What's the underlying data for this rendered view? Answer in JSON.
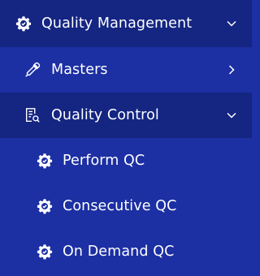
{
  "colors": {
    "header_bg": "#142582",
    "item_bg": "#1c2fa3",
    "text": "#ffffff"
  },
  "menu": {
    "group": {
      "label": "Quality Management",
      "icon": "gear-icon",
      "expanded": true,
      "chevron": "chevron-down-icon"
    },
    "masters": {
      "label": "Masters",
      "icon": "pipette-icon",
      "chevron": "chevron-right-icon"
    },
    "quality_control": {
      "label": "Quality Control",
      "icon": "report-search-icon",
      "expanded": true,
      "chevron": "chevron-down-icon",
      "items": [
        {
          "label": "Perform QC",
          "icon": "gear-icon"
        },
        {
          "label": "Consecutive QC",
          "icon": "gear-icon"
        },
        {
          "label": "On Demand QC",
          "icon": "gear-icon"
        }
      ]
    }
  }
}
